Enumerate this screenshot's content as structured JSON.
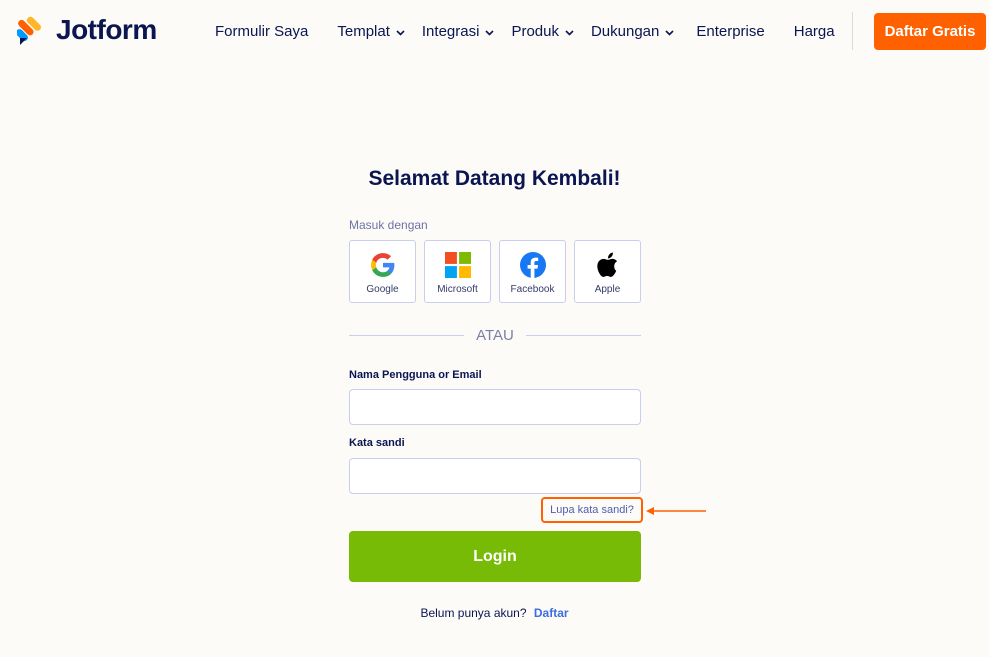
{
  "header": {
    "brand": "Jotform",
    "nav": [
      {
        "label": "Formulir Saya",
        "has_dropdown": false
      },
      {
        "label": "Templat",
        "has_dropdown": true
      },
      {
        "label": "Integrasi",
        "has_dropdown": true
      },
      {
        "label": "Produk",
        "has_dropdown": true
      },
      {
        "label": "Dukungan",
        "has_dropdown": true
      },
      {
        "label": "Enterprise",
        "has_dropdown": false
      },
      {
        "label": "Harga",
        "has_dropdown": false
      }
    ],
    "signup_label": "Daftar Gratis"
  },
  "login": {
    "title": "Selamat Datang Kembali!",
    "signin_with": "Masuk dengan",
    "social": [
      {
        "label": "Google",
        "icon": "google-icon"
      },
      {
        "label": "Microsoft",
        "icon": "microsoft-icon"
      },
      {
        "label": "Facebook",
        "icon": "facebook-icon"
      },
      {
        "label": "Apple",
        "icon": "apple-icon"
      }
    ],
    "or_text": "ATAU",
    "username_label": "Nama Pengguna or Email",
    "username_value": "",
    "password_label": "Kata sandi",
    "password_value": "",
    "forgot_label": "Lupa kata sandi?",
    "login_label": "Login",
    "no_account_text": "Belum punya akun?",
    "register_label": "Daftar"
  },
  "colors": {
    "accent_orange": "#ff6100",
    "login_green": "#78bb07",
    "navy": "#0a1551",
    "link_blue": "#3b6ee0"
  }
}
